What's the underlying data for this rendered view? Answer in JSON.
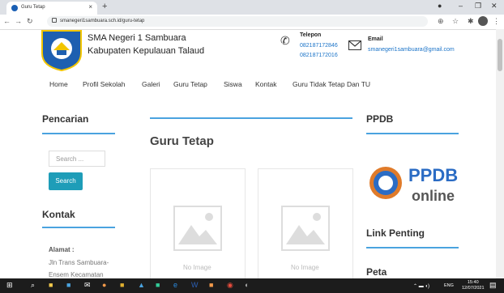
{
  "browser": {
    "tab_title": "Guru Tetap",
    "url": "smanegeri1sambuara.sch.id/guru-tetap"
  },
  "header": {
    "school_name_1": "SMA Negeri 1 Sambuara",
    "school_name_2": "Kabupaten Kepulauan Talaud",
    "phone_label": "Telepon",
    "phone_1": "082187172846",
    "phone_2": "082187172016",
    "email_label": "Email",
    "email_value": "smanegeri1sambuara@gmail.com"
  },
  "menu": [
    "Home",
    "Profil Sekolah",
    "Galeri",
    "Guru Tetap",
    "Siswa",
    "Kontak",
    "Guru Tidak Tetap Dan TU"
  ],
  "sidebar": {
    "search_heading": "Pencarian",
    "search_placeholder": "Search ...",
    "search_button": "Search",
    "contact_heading": "Kontak",
    "address_label": "Alamat :",
    "address_line_1": "Jln Trans Sambuara-",
    "address_line_2": "Ensem Kecamatan"
  },
  "main": {
    "title": "Guru Tetap",
    "cards": [
      {
        "placeholder": "No Image"
      },
      {
        "placeholder": "No Image"
      }
    ]
  },
  "right": {
    "ppdb_heading": "PPDB",
    "ppdb_logo_text": "PPDB",
    "ppdb_logo_sub": "online",
    "links_heading": "Link Penting",
    "map_heading": "Peta"
  },
  "taskbar": {
    "lang": "ENG",
    "time": "15:40",
    "date": "12/07/2021"
  },
  "colors": {
    "accent": "#4aa3df",
    "button": "#1e9db8",
    "link": "#1a73c8"
  }
}
